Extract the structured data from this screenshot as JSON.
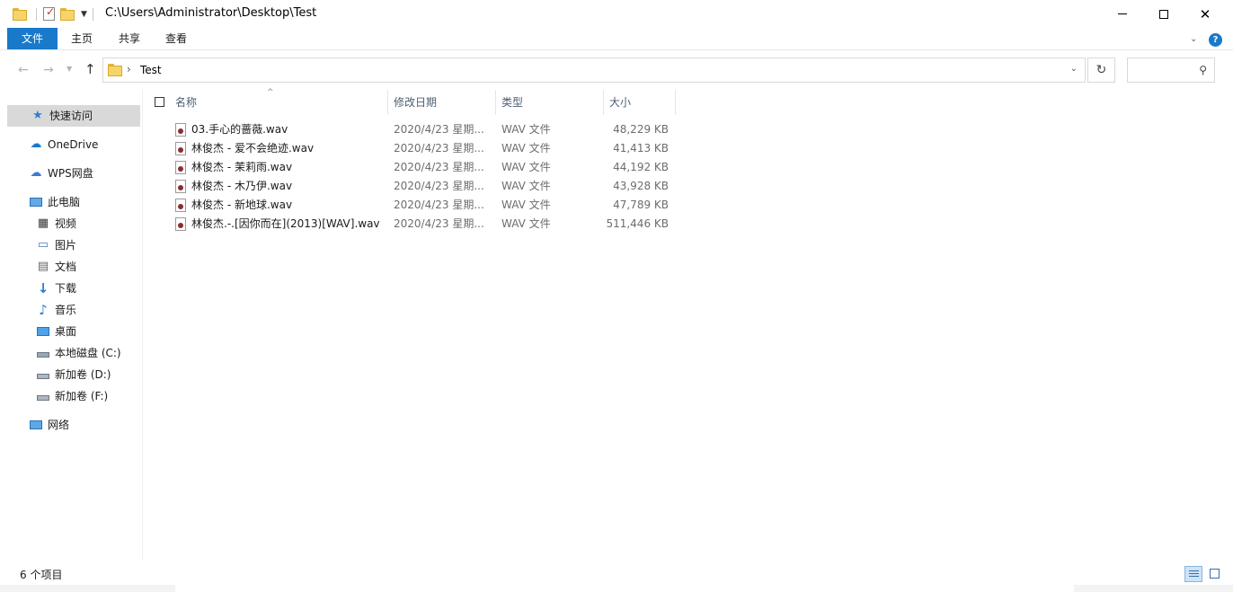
{
  "window": {
    "title_path": "C:\\Users\\Administrator\\Desktop\\Test",
    "icons": [
      "folder-icon",
      "properties-icon",
      "new-folder-icon",
      "chevron-down-icon",
      "minimize-icon",
      "maximize-icon",
      "close-icon"
    ]
  },
  "ribbon": {
    "tabs": [
      {
        "label": "文件",
        "active": true
      },
      {
        "label": "主页"
      },
      {
        "label": "共享"
      },
      {
        "label": "查看"
      }
    ],
    "collapse_icon": "chevron-down-icon",
    "help_glyph": "?"
  },
  "navigation": {
    "breadcrumb": [
      "Test"
    ],
    "search_placeholder": ""
  },
  "sidebar": {
    "items": [
      {
        "label": "快速访问",
        "icon": "star-icon",
        "selected": true
      },
      {
        "label": "OneDrive",
        "icon": "cloud-icon"
      },
      {
        "label": "WPS网盘",
        "icon": "cloud-outline-icon"
      },
      {
        "label": "此电脑",
        "icon": "computer-icon"
      },
      {
        "label": "视频",
        "icon": "video-icon"
      },
      {
        "label": "图片",
        "icon": "picture-icon"
      },
      {
        "label": "文档",
        "icon": "document-icon"
      },
      {
        "label": "下载",
        "icon": "download-icon"
      },
      {
        "label": "音乐",
        "icon": "music-icon"
      },
      {
        "label": "桌面",
        "icon": "desktop-icon"
      },
      {
        "label": "本地磁盘 (C:)",
        "icon": "system-drive-icon"
      },
      {
        "label": "新加卷 (D:)",
        "icon": "drive-icon"
      },
      {
        "label": "新加卷 (F:)",
        "icon": "drive-icon"
      },
      {
        "label": "网络",
        "icon": "network-icon"
      }
    ]
  },
  "file_list": {
    "columns": [
      "名称",
      "修改日期",
      "类型",
      "大小"
    ],
    "rows": [
      {
        "name": "03.手心的蔷薇.wav",
        "date": "2020/4/23 星期...",
        "type": "WAV 文件",
        "size": "48,229 KB"
      },
      {
        "name": "林俊杰 - 爱不会绝迹.wav",
        "date": "2020/4/23 星期...",
        "type": "WAV 文件",
        "size": "41,413 KB"
      },
      {
        "name": "林俊杰 - 茉莉雨.wav",
        "date": "2020/4/23 星期...",
        "type": "WAV 文件",
        "size": "44,192 KB"
      },
      {
        "name": "林俊杰 - 木乃伊.wav",
        "date": "2020/4/23 星期...",
        "type": "WAV 文件",
        "size": "43,928 KB"
      },
      {
        "name": "林俊杰 - 新地球.wav",
        "date": "2020/4/23 星期...",
        "type": "WAV 文件",
        "size": "47,789 KB"
      },
      {
        "name": "林俊杰.-.[因你而在](2013)[WAV].wav",
        "date": "2020/4/23 星期...",
        "type": "WAV 文件",
        "size": "511,446 KB"
      }
    ]
  },
  "status": {
    "item_count": "6 个项目"
  }
}
